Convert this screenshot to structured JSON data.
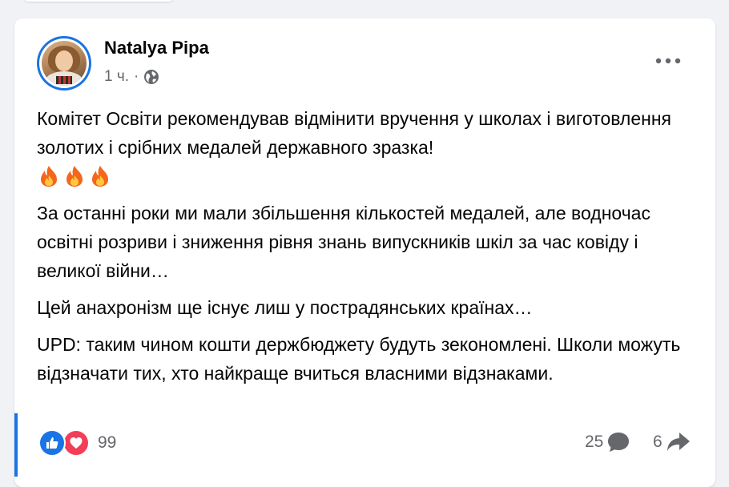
{
  "post": {
    "author": "Natalya Pipa",
    "time": "1 ч.",
    "separator": "·",
    "privacy_icon": "globe-icon",
    "paragraphs": [
      "Комітет Освіти рекомендував відмінити вручення у школах і виготовлення золотих і срібних медалей державного зразка!",
      "За останні роки ми мали збільшення кількостей медалей, але водночас освітні розриви і зниження рівня знань випускників шкіл за час ковіду і великої війни…",
      "Цей анахронізм ще існує лиш у пострадянських країнах…",
      "UPD: таким чином кошти держбюджету будуть зекономлені. Школи можуть відзначати тих, хто найкраще вчиться власними відзнаками."
    ],
    "emojis": [
      "fire-icon",
      "fire-icon",
      "fire-icon"
    ]
  },
  "footer": {
    "reaction_icons": [
      "like-icon",
      "love-icon"
    ],
    "reaction_count": "99",
    "comment_count": "25",
    "share_count": "6"
  },
  "colors": {
    "accent": "#1b74e4",
    "love": "#f33e58",
    "secondary_text": "#65676b",
    "page_background": "#f0f2f5"
  }
}
